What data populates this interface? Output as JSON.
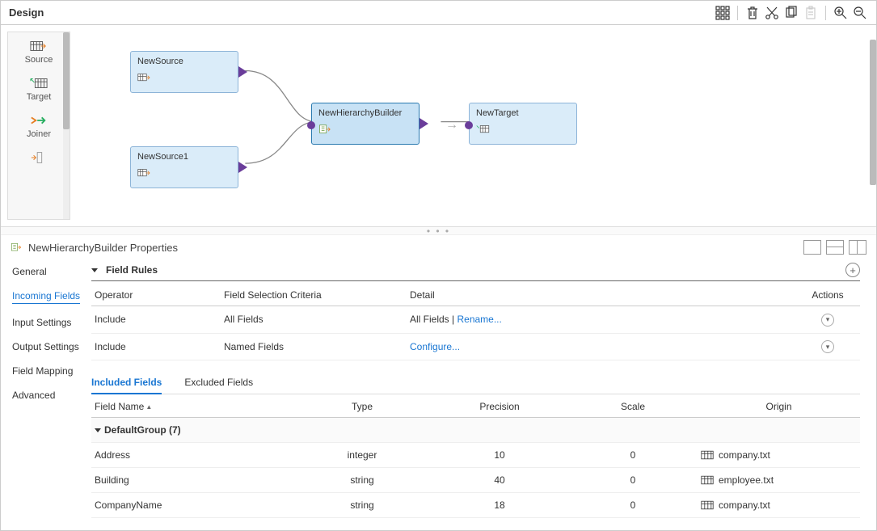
{
  "header": {
    "title": "Design"
  },
  "palette": [
    {
      "label": "Source",
      "icon": "source"
    },
    {
      "label": "Target",
      "icon": "target"
    },
    {
      "label": "Joiner",
      "icon": "joiner"
    },
    {
      "label": "",
      "icon": "more"
    }
  ],
  "nodes": {
    "src1": {
      "label": "NewSource"
    },
    "src2": {
      "label": "NewSource1"
    },
    "hier": {
      "label": "NewHierarchyBuilder"
    },
    "tgt": {
      "label": "NewTarget"
    }
  },
  "propsTitle": "NewHierarchyBuilder Properties",
  "sideTabs": [
    "General",
    "Incoming Fields",
    "Input Settings",
    "Output Settings",
    "Field Mapping",
    "Advanced"
  ],
  "sectionTitle": "Field Rules",
  "rulesHeaders": {
    "operator": "Operator",
    "criteria": "Field Selection Criteria",
    "detail": "Detail",
    "actions": "Actions"
  },
  "rules": [
    {
      "operator": "Include",
      "criteria": "All Fields",
      "detail_text": "All Fields",
      "detail_sep": " | ",
      "detail_link": "Rename..."
    },
    {
      "operator": "Include",
      "criteria": "Named Fields",
      "detail_link": "Configure..."
    }
  ],
  "subtabs": {
    "included": "Included Fields",
    "excluded": "Excluded Fields"
  },
  "fieldsHeaders": {
    "name": "Field Name",
    "type": "Type",
    "precision": "Precision",
    "scale": "Scale",
    "origin": "Origin"
  },
  "group": {
    "label": "DefaultGroup",
    "count": "(7)"
  },
  "fields": [
    {
      "name": "Address",
      "type": "integer",
      "precision": "10",
      "scale": "0",
      "origin": "company.txt"
    },
    {
      "name": "Building",
      "type": "string",
      "precision": "40",
      "scale": "0",
      "origin": "employee.txt"
    },
    {
      "name": "CompanyName",
      "type": "string",
      "precision": "18",
      "scale": "0",
      "origin": "company.txt"
    }
  ]
}
